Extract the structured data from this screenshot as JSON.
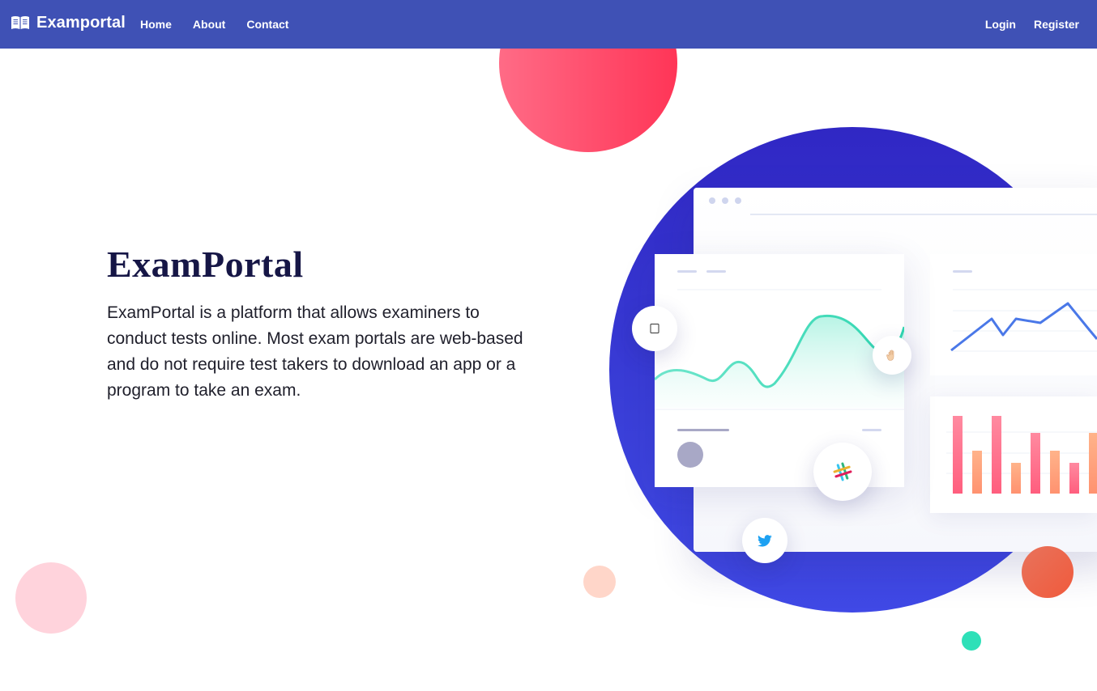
{
  "nav": {
    "brand": "Examportal",
    "links_left": [
      "Home",
      "About",
      "Contact"
    ],
    "links_right": [
      "Login",
      "Register"
    ]
  },
  "hero": {
    "title": "ExamPortal",
    "description": "ExamPortal is a platform that allows examiners to conduct tests online. Most exam portals are web-based and do not require test takers to download an app or a program to take an exam."
  },
  "illustration": {
    "icons": [
      "apple-icon",
      "wave-hand-icon",
      "slack-icon",
      "twitter-icon"
    ]
  },
  "colors": {
    "nav_bg": "#3f51b5",
    "title": "#161646",
    "circle_red": "#ff4466",
    "circle_blue": "#3630cf",
    "teal": "#2ee0b8"
  }
}
